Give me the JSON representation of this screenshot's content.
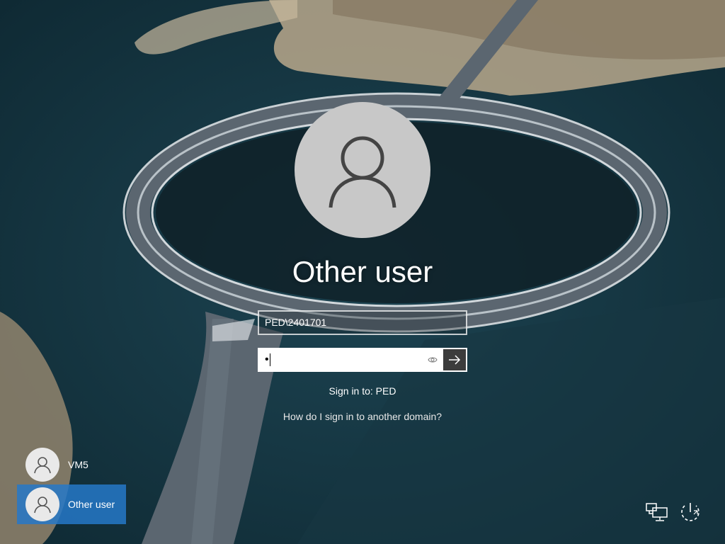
{
  "login": {
    "user_display_name": "Other user",
    "username_value": "PED\\2401701",
    "password_mask": "•",
    "sign_in_to": "Sign in to: PED",
    "other_domain_link": "How do I sign in to another domain?"
  },
  "user_list": [
    {
      "label": "VM5",
      "selected": false
    },
    {
      "label": "Other user",
      "selected": true
    }
  ],
  "icons": {
    "user_avatar": "person-icon",
    "password_reveal": "eye-icon",
    "submit": "arrow-right-icon",
    "network": "network-icon",
    "power": "power-icon"
  },
  "colors": {
    "selected_tile": "#2678c8",
    "avatar_bg": "#c8c8c8",
    "submit_bg": "#3c3c3c"
  }
}
